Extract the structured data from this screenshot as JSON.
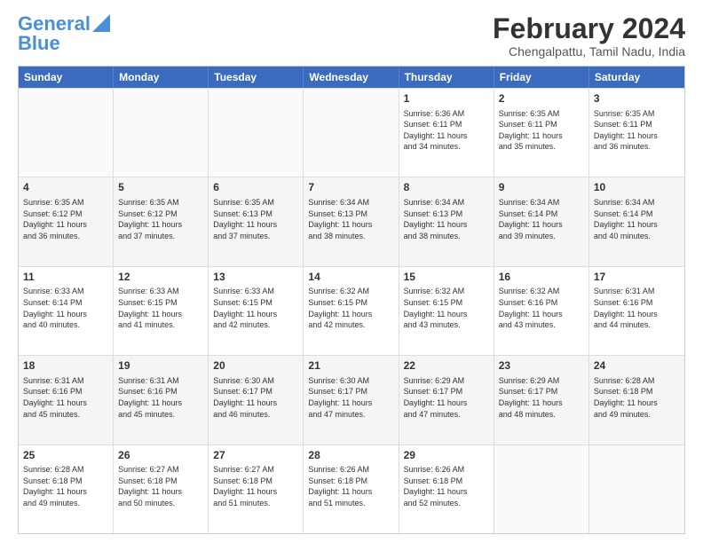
{
  "logo": {
    "line1": "General",
    "line2": "Blue"
  },
  "title": "February 2024",
  "location": "Chengalpattu, Tamil Nadu, India",
  "days": [
    "Sunday",
    "Monday",
    "Tuesday",
    "Wednesday",
    "Thursday",
    "Friday",
    "Saturday"
  ],
  "rows": [
    [
      {
        "day": "",
        "info": ""
      },
      {
        "day": "",
        "info": ""
      },
      {
        "day": "",
        "info": ""
      },
      {
        "day": "",
        "info": ""
      },
      {
        "day": "1",
        "info": "Sunrise: 6:36 AM\nSunset: 6:11 PM\nDaylight: 11 hours\nand 34 minutes."
      },
      {
        "day": "2",
        "info": "Sunrise: 6:35 AM\nSunset: 6:11 PM\nDaylight: 11 hours\nand 35 minutes."
      },
      {
        "day": "3",
        "info": "Sunrise: 6:35 AM\nSunset: 6:11 PM\nDaylight: 11 hours\nand 36 minutes."
      }
    ],
    [
      {
        "day": "4",
        "info": "Sunrise: 6:35 AM\nSunset: 6:12 PM\nDaylight: 11 hours\nand 36 minutes."
      },
      {
        "day": "5",
        "info": "Sunrise: 6:35 AM\nSunset: 6:12 PM\nDaylight: 11 hours\nand 37 minutes."
      },
      {
        "day": "6",
        "info": "Sunrise: 6:35 AM\nSunset: 6:13 PM\nDaylight: 11 hours\nand 37 minutes."
      },
      {
        "day": "7",
        "info": "Sunrise: 6:34 AM\nSunset: 6:13 PM\nDaylight: 11 hours\nand 38 minutes."
      },
      {
        "day": "8",
        "info": "Sunrise: 6:34 AM\nSunset: 6:13 PM\nDaylight: 11 hours\nand 38 minutes."
      },
      {
        "day": "9",
        "info": "Sunrise: 6:34 AM\nSunset: 6:14 PM\nDaylight: 11 hours\nand 39 minutes."
      },
      {
        "day": "10",
        "info": "Sunrise: 6:34 AM\nSunset: 6:14 PM\nDaylight: 11 hours\nand 40 minutes."
      }
    ],
    [
      {
        "day": "11",
        "info": "Sunrise: 6:33 AM\nSunset: 6:14 PM\nDaylight: 11 hours\nand 40 minutes."
      },
      {
        "day": "12",
        "info": "Sunrise: 6:33 AM\nSunset: 6:15 PM\nDaylight: 11 hours\nand 41 minutes."
      },
      {
        "day": "13",
        "info": "Sunrise: 6:33 AM\nSunset: 6:15 PM\nDaylight: 11 hours\nand 42 minutes."
      },
      {
        "day": "14",
        "info": "Sunrise: 6:32 AM\nSunset: 6:15 PM\nDaylight: 11 hours\nand 42 minutes."
      },
      {
        "day": "15",
        "info": "Sunrise: 6:32 AM\nSunset: 6:15 PM\nDaylight: 11 hours\nand 43 minutes."
      },
      {
        "day": "16",
        "info": "Sunrise: 6:32 AM\nSunset: 6:16 PM\nDaylight: 11 hours\nand 43 minutes."
      },
      {
        "day": "17",
        "info": "Sunrise: 6:31 AM\nSunset: 6:16 PM\nDaylight: 11 hours\nand 44 minutes."
      }
    ],
    [
      {
        "day": "18",
        "info": "Sunrise: 6:31 AM\nSunset: 6:16 PM\nDaylight: 11 hours\nand 45 minutes."
      },
      {
        "day": "19",
        "info": "Sunrise: 6:31 AM\nSunset: 6:16 PM\nDaylight: 11 hours\nand 45 minutes."
      },
      {
        "day": "20",
        "info": "Sunrise: 6:30 AM\nSunset: 6:17 PM\nDaylight: 11 hours\nand 46 minutes."
      },
      {
        "day": "21",
        "info": "Sunrise: 6:30 AM\nSunset: 6:17 PM\nDaylight: 11 hours\nand 47 minutes."
      },
      {
        "day": "22",
        "info": "Sunrise: 6:29 AM\nSunset: 6:17 PM\nDaylight: 11 hours\nand 47 minutes."
      },
      {
        "day": "23",
        "info": "Sunrise: 6:29 AM\nSunset: 6:17 PM\nDaylight: 11 hours\nand 48 minutes."
      },
      {
        "day": "24",
        "info": "Sunrise: 6:28 AM\nSunset: 6:18 PM\nDaylight: 11 hours\nand 49 minutes."
      }
    ],
    [
      {
        "day": "25",
        "info": "Sunrise: 6:28 AM\nSunset: 6:18 PM\nDaylight: 11 hours\nand 49 minutes."
      },
      {
        "day": "26",
        "info": "Sunrise: 6:27 AM\nSunset: 6:18 PM\nDaylight: 11 hours\nand 50 minutes."
      },
      {
        "day": "27",
        "info": "Sunrise: 6:27 AM\nSunset: 6:18 PM\nDaylight: 11 hours\nand 51 minutes."
      },
      {
        "day": "28",
        "info": "Sunrise: 6:26 AM\nSunset: 6:18 PM\nDaylight: 11 hours\nand 51 minutes."
      },
      {
        "day": "29",
        "info": "Sunrise: 6:26 AM\nSunset: 6:18 PM\nDaylight: 11 hours\nand 52 minutes."
      },
      {
        "day": "",
        "info": ""
      },
      {
        "day": "",
        "info": ""
      }
    ]
  ]
}
